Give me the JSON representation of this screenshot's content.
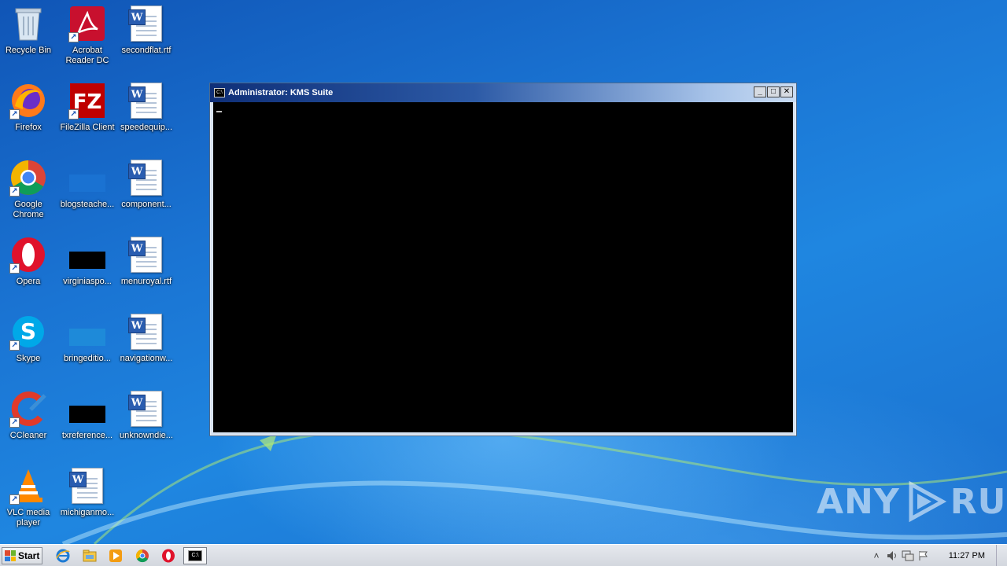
{
  "desktop": {
    "icons": [
      {
        "label": "Recycle Bin",
        "icon": "recycle-bin-icon"
      },
      {
        "label": "Acrobat Reader DC",
        "icon": "acrobat-icon"
      },
      {
        "label": "secondflat.rtf",
        "icon": "word-doc-icon"
      },
      {
        "label": "Firefox",
        "icon": "firefox-icon"
      },
      {
        "label": "FileZilla Client",
        "icon": "filezilla-icon"
      },
      {
        "label": "speedequip...",
        "icon": "word-doc-icon"
      },
      {
        "label": "Google Chrome",
        "icon": "chrome-icon"
      },
      {
        "label": "blogsteache...",
        "icon": "file-thumb-icon"
      },
      {
        "label": "component...",
        "icon": "word-doc-icon"
      },
      {
        "label": "Opera",
        "icon": "opera-icon"
      },
      {
        "label": "virginiaspo...",
        "icon": "file-thumb-icon"
      },
      {
        "label": "menuroyal.rtf",
        "icon": "word-doc-icon"
      },
      {
        "label": "Skype",
        "icon": "skype-icon"
      },
      {
        "label": "bringeditio...",
        "icon": "file-thumb-icon"
      },
      {
        "label": "navigationw...",
        "icon": "word-doc-icon"
      },
      {
        "label": "CCleaner",
        "icon": "ccleaner-icon"
      },
      {
        "label": "txreference...",
        "icon": "file-thumb-icon"
      },
      {
        "label": "unknowndie...",
        "icon": "word-doc-icon"
      },
      {
        "label": "VLC media player",
        "icon": "vlc-icon"
      },
      {
        "label": "michiganmo...",
        "icon": "word-doc-icon"
      }
    ]
  },
  "console": {
    "title": "Administrator:  KMS Suite",
    "icon": "cmd-icon",
    "buttons": {
      "minimize": "_",
      "maximize": "□",
      "close": "✕"
    }
  },
  "watermark": {
    "left": "ANY",
    "right": "RUN"
  },
  "taskbar": {
    "start_label": "Start",
    "pinned": [
      "ie-icon",
      "explorer-icon",
      "media-player-icon",
      "chrome-icon",
      "opera-icon",
      "cmd-icon"
    ],
    "tray": {
      "chevron": "˄",
      "clock": "11:27 PM"
    }
  },
  "colors": {
    "desktop_blue": "#1a74d3",
    "console_bg": "#000000",
    "title_dark": "#0f2f78"
  }
}
